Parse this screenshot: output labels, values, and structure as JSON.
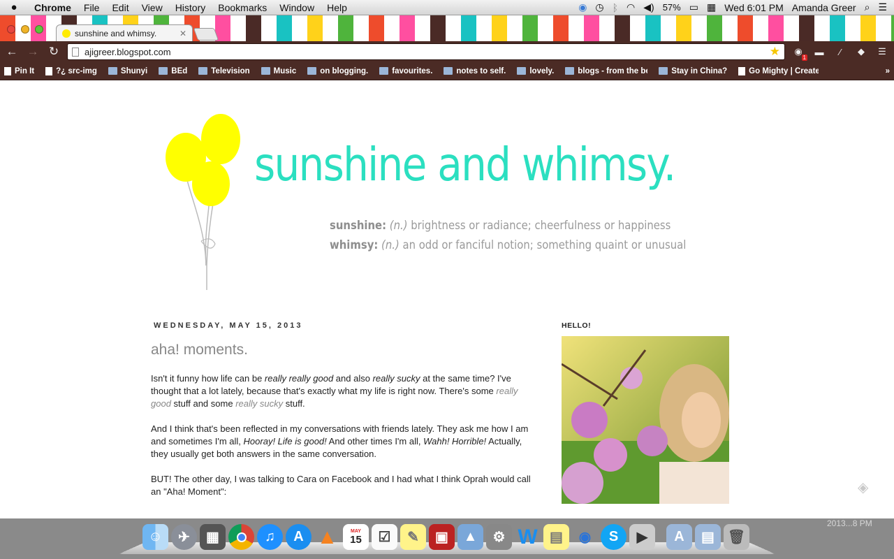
{
  "menubar": {
    "apple": "",
    "app_name": "Chrome",
    "menus": [
      "File",
      "Edit",
      "View",
      "History",
      "Bookmarks",
      "Window",
      "Help"
    ],
    "battery": "57%",
    "clock": "Wed 6:01 PM",
    "user": "Amanda Greer"
  },
  "tab": {
    "title": "sunshine and whimsy.",
    "close": "✕"
  },
  "toolbar": {
    "url": "ajigreer.blogspot.com",
    "back": "←",
    "forward": "→",
    "reload": "↻",
    "star": "★",
    "menu": "☰",
    "rss_badge": "1"
  },
  "bookmarks": [
    {
      "label": "Pin It",
      "icon": "page"
    },
    {
      "label": "?¿ src-img",
      "icon": "page"
    },
    {
      "label": "Shunyi",
      "icon": "folder"
    },
    {
      "label": "BEd",
      "icon": "folder"
    },
    {
      "label": "Television",
      "icon": "folder"
    },
    {
      "label": "Music",
      "icon": "folder"
    },
    {
      "label": "on blogging.",
      "icon": "folder"
    },
    {
      "label": "favourites.",
      "icon": "folder"
    },
    {
      "label": "notes to self.",
      "icon": "folder"
    },
    {
      "label": "lovely.",
      "icon": "folder"
    },
    {
      "label": "blogs - from the be",
      "icon": "folder"
    },
    {
      "label": "Stay in China?",
      "icon": "folder"
    },
    {
      "label": "Go Mighty | Create a",
      "icon": "page"
    }
  ],
  "blog": {
    "title": "sunshine and whimsy.",
    "def1_term": "sunshine:",
    "def1_pos": "(n.)",
    "def1_text": "brightness or radiance; cheerfulness or happiness",
    "def2_term": "whimsy:",
    "def2_pos": "(n.)",
    "def2_text": "an odd or fanciful notion; something quaint or unusual",
    "post_date": "WEDNESDAY, MAY 15, 2013",
    "post_title": "aha! moments.",
    "p1": [
      "Isn't it funny how life can be ",
      "really really good",
      " and also ",
      "really sucky",
      " at the same time? I've thought that a lot lately, because that's exactly what my life is right now. There's some ",
      "really good",
      " stuff and some ",
      "really sucky",
      " stuff."
    ],
    "p2": [
      "And I think that's been reflected in my conversations with friends lately. They ask me how I am and sometimes I'm all, ",
      "Hooray! Life is good!",
      " And other times I'm all, ",
      "Wahh! Horrible!",
      " Actually, they usually get both answers in the same conversation."
    ],
    "p3": "BUT! The other day, I was talking to Cara on Facebook and I had what I think Oprah would call an \"Aha! Moment\":",
    "sidebar_heading": "HELLO!"
  },
  "desktop": {
    "corner_label": "2013...8 PM",
    "dock_calendar_day": "15",
    "dock_calendar_month": "MAY"
  },
  "colors": {
    "accent": "#2bdfc0",
    "toolbar": "#4b2b25",
    "balloon": "#ffff00"
  }
}
